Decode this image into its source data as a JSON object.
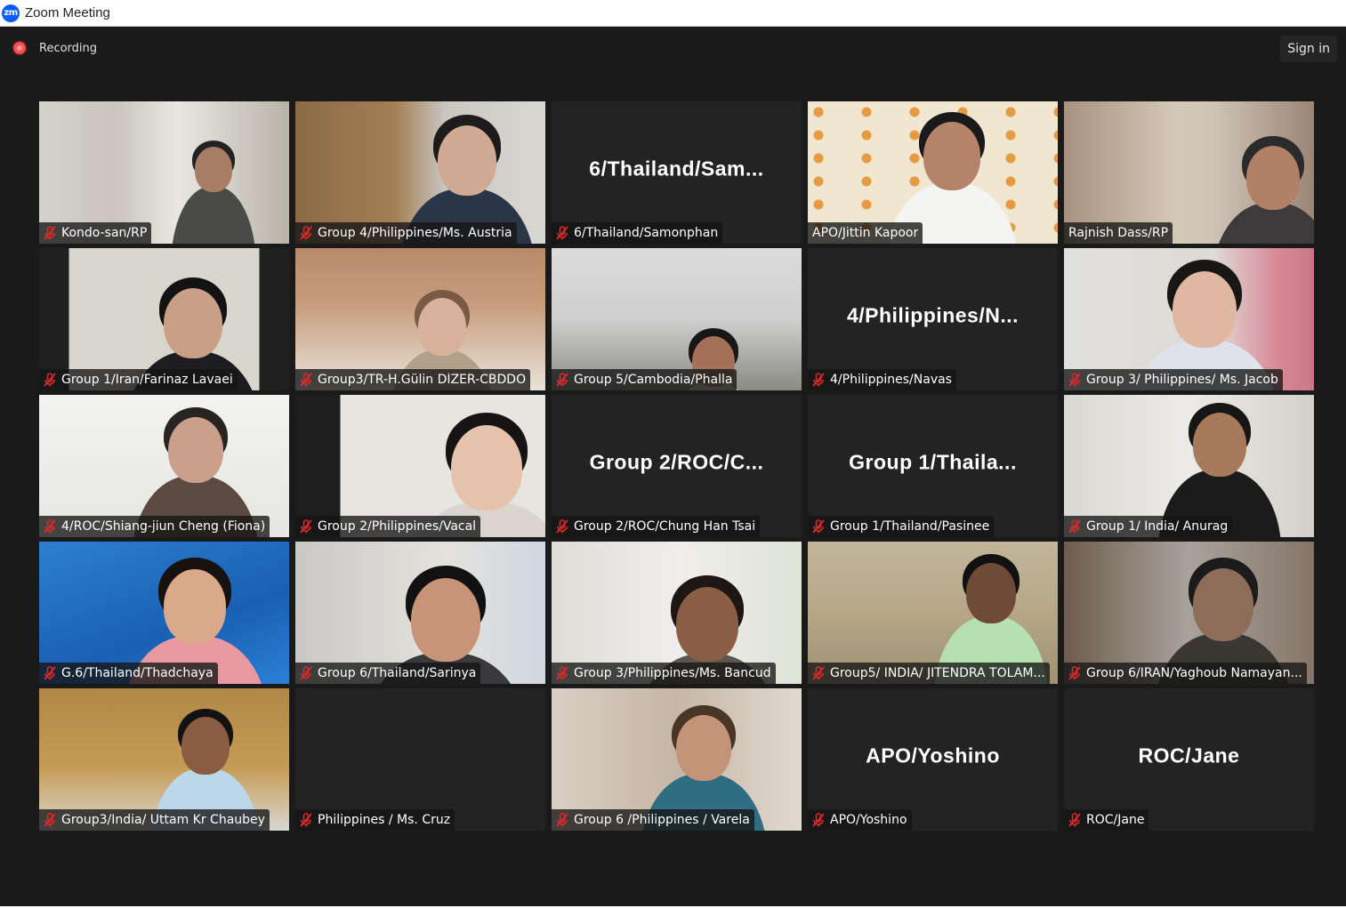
{
  "window": {
    "title": "Zoom Meeting",
    "logo_text": "zm"
  },
  "topbar": {
    "recording_label": "Recording",
    "signin_label": "Sign in"
  },
  "colors": {
    "active_speaker_border": "#d7ef5b",
    "muted_icon": "#e02828",
    "recording_dot": "#ff4d4d"
  },
  "participants": [
    {
      "name": "Kondo-san/RP",
      "video": true,
      "muted": true
    },
    {
      "name": "Group 4/Philippines/Ms. Austria",
      "video": true,
      "muted": true
    },
    {
      "name": "6/Thailand/Samonphan",
      "video": false,
      "placeholder": "6/Thailand/Sam...",
      "muted": true
    },
    {
      "name": "APO/Jittin Kapoor",
      "video": true,
      "muted": false,
      "active_speaker": true
    },
    {
      "name": "Rajnish Dass/RP",
      "video": true,
      "muted": false
    },
    {
      "name": "Group 1/Iran/Farinaz Lavaei",
      "video": true,
      "muted": true
    },
    {
      "name": "Group3/TR-H.Gülin DİZER-CBDDO",
      "video": true,
      "muted": true
    },
    {
      "name": "Group 5/Cambodia/Phalla",
      "video": true,
      "muted": true
    },
    {
      "name": "4/Philippines/Navas",
      "video": false,
      "placeholder": "4/Philippines/N...",
      "muted": true
    },
    {
      "name": "Group 3/ Philippines/ Ms. Jacob",
      "video": true,
      "muted": true
    },
    {
      "name": "4/ROC/Shiang-jiun Cheng (Fiona)",
      "video": true,
      "muted": true
    },
    {
      "name": "Group 2/Philippines/Vacal",
      "video": true,
      "muted": true
    },
    {
      "name": "Group 2/ROC/Chung Han Tsai",
      "video": false,
      "placeholder": "Group  2/ROC/C...",
      "muted": true
    },
    {
      "name": "Group 1/Thailand/Pasinee",
      "video": false,
      "placeholder": "Group  1/Thaila...",
      "muted": true
    },
    {
      "name": "Group 1/ India/ Anurag",
      "video": true,
      "muted": true
    },
    {
      "name": "G.6/Thailand/Thadchaya",
      "video": true,
      "muted": true
    },
    {
      "name": "Group 6/Thailand/Sarinya",
      "video": true,
      "muted": true
    },
    {
      "name": "Group 3/Philippines/Ms. Bancud",
      "video": true,
      "muted": true
    },
    {
      "name": "Group5/ INDIA/ JITENDRA TOLAM...",
      "video": true,
      "muted": true
    },
    {
      "name": "Group 6/IRAN/Yaghoub Namayan...",
      "video": true,
      "muted": true
    },
    {
      "name": "Group3/India/ Uttam Kr Chaubey",
      "video": true,
      "muted": true
    },
    {
      "name": "Philippines / Ms. Cruz",
      "video": false,
      "placeholder": "",
      "muted": true
    },
    {
      "name": "Group 6 /Philippines / Varela",
      "video": true,
      "muted": true
    },
    {
      "name": "APO/Yoshino",
      "video": false,
      "placeholder": "APO/Yoshino",
      "muted": true
    },
    {
      "name": "ROC/Jane",
      "video": false,
      "placeholder": "ROC/Jane",
      "muted": true
    }
  ]
}
